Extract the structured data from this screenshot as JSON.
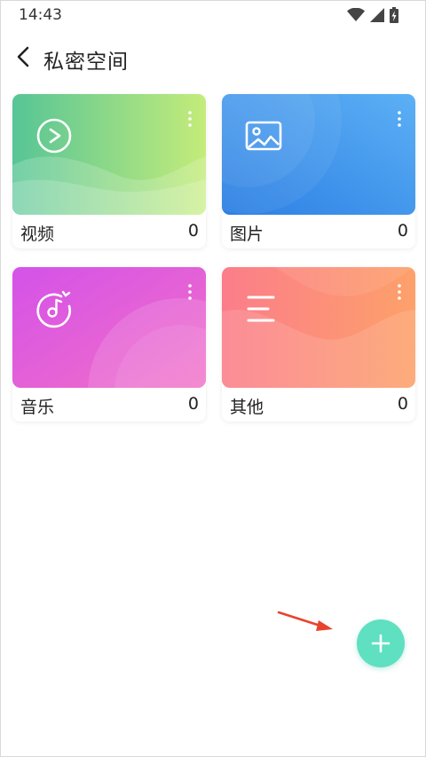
{
  "status_bar": {
    "time": "14:43"
  },
  "header": {
    "title": "私密空间"
  },
  "cards": [
    {
      "label": "视频",
      "count": "0",
      "icon": "play-circle-icon",
      "gradient": [
        "#56c596",
        "#c4ec7a"
      ]
    },
    {
      "label": "图片",
      "count": "0",
      "icon": "image-icon",
      "gradient": [
        "#2c7fe3",
        "#5cb0f5"
      ]
    },
    {
      "label": "音乐",
      "count": "0",
      "icon": "music-note-icon",
      "gradient": [
        "#d452e8",
        "#f26fc7"
      ]
    },
    {
      "label": "其他",
      "count": "0",
      "icon": "menu-lines-icon",
      "gradient": [
        "#fb7d8a",
        "#fda16a"
      ]
    }
  ],
  "fab": {
    "icon": "plus-icon",
    "color": "#5fe0c0"
  },
  "annotation": {
    "color": "#e8432d"
  }
}
